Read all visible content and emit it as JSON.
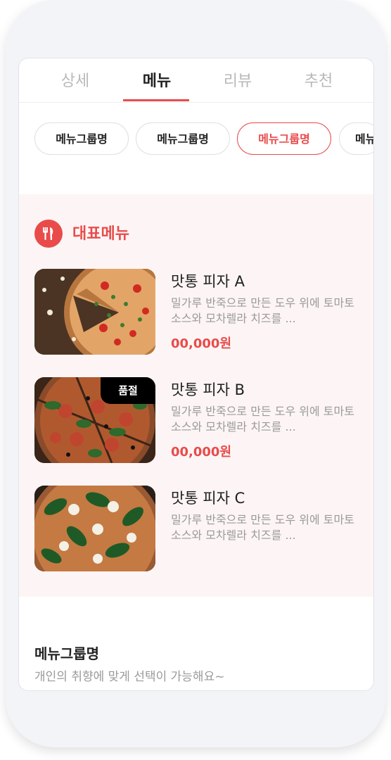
{
  "tabs": [
    {
      "label": "상세",
      "active": false
    },
    {
      "label": "메뉴",
      "active": true
    },
    {
      "label": "리뷰",
      "active": false
    },
    {
      "label": "추천",
      "active": false
    }
  ],
  "chips": [
    {
      "label": "메뉴그룹명",
      "active": false
    },
    {
      "label": "메뉴그룹명",
      "active": false
    },
    {
      "label": "메뉴그룹명",
      "active": true
    },
    {
      "label": "메뉴그룹명",
      "active": false
    }
  ],
  "featured": {
    "title": "대표메뉴",
    "icon": "fork-knife-icon",
    "items": [
      {
        "name": "맛통 피자 A",
        "desc": "밀가루 반죽으로 만든 도우 위에 토마토 소스와 모차렐라 치즈를 ...",
        "price": "00,000원",
        "sold_out": false
      },
      {
        "name": "맛통 피자 B",
        "desc": "밀가루 반죽으로 만든 도우 위에 토마토 소스와 모차렐라 치즈를 ...",
        "price": "00,000원",
        "sold_out": true,
        "sold_out_label": "품절"
      },
      {
        "name": "맛통 피자 C",
        "desc": "밀가루 반죽으로 만든 도우 위에 토마토 소스와 모차렐라 치즈를 ...",
        "price": "",
        "sold_out": false
      }
    ]
  },
  "group": {
    "title": "메뉴그룹명",
    "desc": "개인의 취향에 맞게 선택이 가능해요~"
  },
  "colors": {
    "accent": "#e94b4b",
    "featured_bg": "#fdf5f5"
  }
}
